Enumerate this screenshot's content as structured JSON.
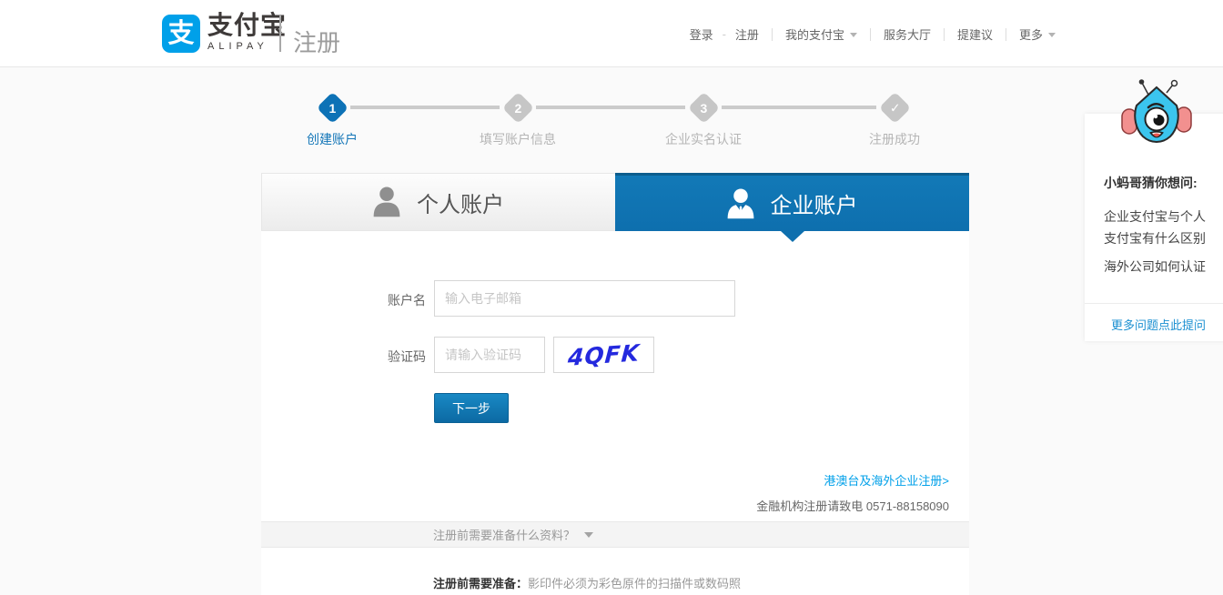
{
  "header": {
    "brand_glyph": "支",
    "brand_cn": "支付宝",
    "brand_en": "ALIPAY",
    "page_title": "注册",
    "nav": {
      "login": "登录",
      "dash": "-",
      "register": "注册",
      "my_alipay": "我的支付宝",
      "service_hall": "服务大厅",
      "feedback": "提建议",
      "more": "更多"
    }
  },
  "steps": {
    "items": [
      {
        "num": "1",
        "label": "创建账户"
      },
      {
        "num": "2",
        "label": "填写账户信息"
      },
      {
        "num": "3",
        "label": "企业实名认证"
      },
      {
        "num": "✓",
        "label": "注册成功"
      }
    ]
  },
  "tabs": {
    "personal": "个人账户",
    "enterprise": "企业账户"
  },
  "form": {
    "account_label": "账户名",
    "account_placeholder": "输入电子邮箱",
    "captcha_label": "验证码",
    "captcha_placeholder": "请输入验证码",
    "captcha_code": "4QFK",
    "next_button": "下一步",
    "overseas_link": "港澳台及海外企业注册>",
    "finance_note": "金融机构注册请致电 0571-88158090"
  },
  "prepare": {
    "bar_question": "注册前需要准备什么资料？",
    "note_bold": "注册前需要准备：",
    "note_text": "影印件必须为彩色原件的扫描件或数码照"
  },
  "assistant": {
    "title": "小蚂哥猜你想问:",
    "question1": "企业支付宝与个人支付宝有什么区别",
    "question2": "海外公司如何认证",
    "more_link": "更多问题点此提问"
  },
  "colors": {
    "brand_blue": "#00a0e9",
    "tab_blue": "#0e6fae",
    "step_active_blue": "#0d72b6",
    "link_blue": "#00a0e9",
    "captcha_blue": "#2429de"
  }
}
